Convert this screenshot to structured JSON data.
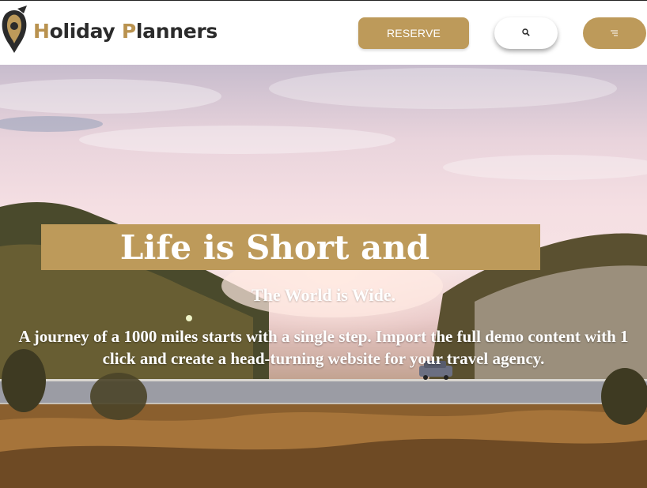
{
  "header": {
    "logo": {
      "text_accent_1": "H",
      "text_1": "oliday ",
      "text_accent_2": "P",
      "text_2": "lanners",
      "icon": "map-pin-icon"
    },
    "reserve_label": "RESERVE",
    "search_icon": "search-icon",
    "menu_icon": "menu-icon"
  },
  "hero": {
    "headline": "Life is Short and",
    "subheadline": "The World is Wide.",
    "body": "A journey of a 1000 miles starts with a single step. Import the full demo content with 1 click and create a head-turning website for your travel agency."
  },
  "colors": {
    "accent": "#bd9a5a",
    "text_dark": "#2b2b2b",
    "white": "#ffffff"
  }
}
